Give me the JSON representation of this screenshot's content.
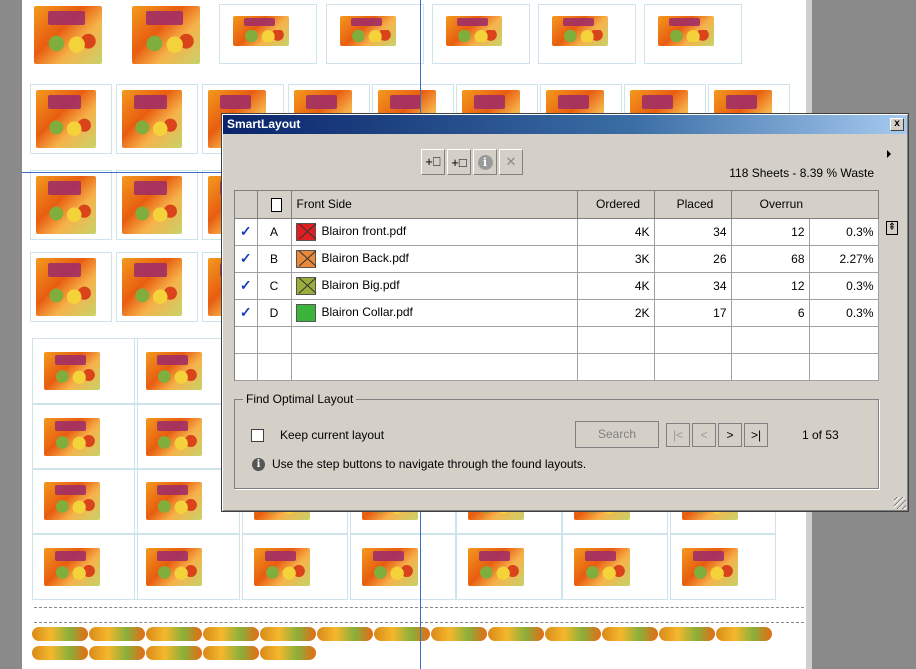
{
  "dialog": {
    "title": "SmartLayout",
    "close_glyph": "x",
    "toolbar": {
      "add_layout_glyph": "+⎕",
      "add_sheet_glyph": "+□",
      "info_glyph": "i",
      "delete_glyph": "✕"
    },
    "sheets_info": "118 Sheets - 8.39 % Waste"
  },
  "table": {
    "headers": [
      "",
      "",
      "Front Side",
      "Ordered",
      "Placed",
      "Overrun",
      ""
    ],
    "rows": [
      {
        "check": "✓",
        "id": "A",
        "color": "#e02020",
        "name": "Blairon front.pdf",
        "ordered": "4K",
        "placed": "34",
        "overrun": "12",
        "overrun_pct": "0.3%"
      },
      {
        "check": "✓",
        "id": "B",
        "color": "#e8893c",
        "name": "Blairon Back.pdf",
        "ordered": "3K",
        "placed": "26",
        "overrun": "68",
        "overrun_pct": "2.27%"
      },
      {
        "check": "✓",
        "id": "C",
        "color": "#9aae3c",
        "name": "Blairon Big.pdf",
        "ordered": "4K",
        "placed": "34",
        "overrun": "12",
        "overrun_pct": "0.3%"
      },
      {
        "check": "✓",
        "id": "D",
        "color": "#3cb43c",
        "name": "Blairon Collar.pdf",
        "ordered": "2K",
        "placed": "17",
        "overrun": "6",
        "overrun_pct": "0.3%"
      }
    ]
  },
  "optimal": {
    "group_title": "Find Optimal Layout",
    "keep_label": "Keep current layout",
    "search_label": "Search",
    "first_glyph": "|<",
    "prev_glyph": "<",
    "next_glyph": ">",
    "last_glyph": ">|",
    "counter": "1 of 53",
    "info_glyph": "i",
    "hint": "Use the step buttons to navigate through the found layouts."
  }
}
